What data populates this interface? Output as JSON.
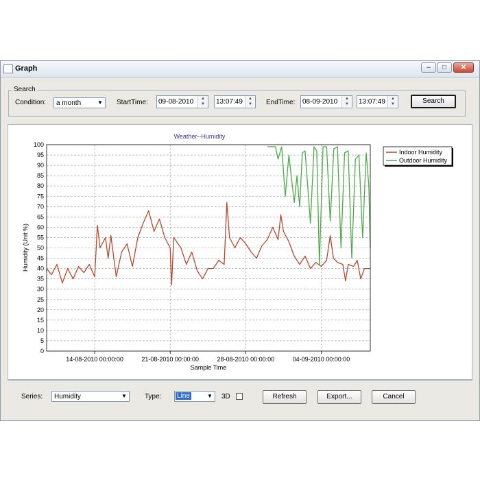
{
  "window": {
    "title": "Graph"
  },
  "search": {
    "group_label": "Search",
    "condition_label": "Condition:",
    "condition_value": "a month",
    "start_label": "StartTime:",
    "start_date": "09-08-2010",
    "start_time": "13:07:49",
    "end_label": "EndTime:",
    "end_date": "08-09-2010",
    "end_time": "13:07:49",
    "search_button": "Search"
  },
  "bottom": {
    "series_label": "Series:",
    "series_value": "Humidity",
    "type_label": "Type:",
    "type_value": "Line",
    "threed_label": "3D",
    "refresh_button": "Refresh",
    "export_button": "Export...",
    "cancel_button": "Cancel"
  },
  "colors": {
    "indoor": "#b8472a",
    "outdoor": "#4cab46"
  },
  "chart_data": {
    "type": "line",
    "title": "Weather--Humidity",
    "xlabel": "Sample Time",
    "ylabel": "Humidity (Unit:%)",
    "ylim": [
      0,
      100
    ],
    "yticks": [
      0,
      5,
      10,
      15,
      20,
      25,
      30,
      35,
      40,
      45,
      50,
      55,
      60,
      65,
      70,
      75,
      80,
      85,
      90,
      95,
      100
    ],
    "xlim": [
      "2010-08-09 13:07:49",
      "2010-09-08 13:07:49"
    ],
    "xtick_labels": [
      "14-08-2010 00:00:00",
      "21-08-2010 00:00:00",
      "28-08-2010 00:00:00",
      "04-09-2010 00:00:00"
    ],
    "xticks": [
      "2010-08-14 00:00:00",
      "2010-08-21 00:00:00",
      "2010-08-28 00:00:00",
      "2010-09-04 00:00:00"
    ],
    "grid": true,
    "legend_position": "top-right",
    "series": [
      {
        "name": "Indoor Humidity",
        "color": "#b8472a",
        "points": [
          [
            "2010-08-09 13:00",
            40
          ],
          [
            "2010-08-10 00:00",
            37
          ],
          [
            "2010-08-10 12:00",
            42
          ],
          [
            "2010-08-11 00:00",
            33
          ],
          [
            "2010-08-11 12:00",
            40
          ],
          [
            "2010-08-12 00:00",
            35
          ],
          [
            "2010-08-12 12:00",
            41
          ],
          [
            "2010-08-13 00:00",
            38
          ],
          [
            "2010-08-13 12:00",
            42
          ],
          [
            "2010-08-14 00:00",
            36
          ],
          [
            "2010-08-14 06:00",
            61
          ],
          [
            "2010-08-14 12:00",
            50
          ],
          [
            "2010-08-15 00:00",
            55
          ],
          [
            "2010-08-15 06:00",
            45
          ],
          [
            "2010-08-15 12:00",
            56
          ],
          [
            "2010-08-16 00:00",
            36
          ],
          [
            "2010-08-16 12:00",
            48
          ],
          [
            "2010-08-17 00:00",
            52
          ],
          [
            "2010-08-17 12:00",
            41
          ],
          [
            "2010-08-18 00:00",
            55
          ],
          [
            "2010-08-18 12:00",
            62
          ],
          [
            "2010-08-19 00:00",
            68
          ],
          [
            "2010-08-19 12:00",
            58
          ],
          [
            "2010-08-20 00:00",
            64
          ],
          [
            "2010-08-20 12:00",
            55
          ],
          [
            "2010-08-21 00:00",
            50
          ],
          [
            "2010-08-21 03:00",
            32
          ],
          [
            "2010-08-21 08:00",
            55
          ],
          [
            "2010-08-22 00:00",
            50
          ],
          [
            "2010-08-22 12:00",
            42
          ],
          [
            "2010-08-23 00:00",
            48
          ],
          [
            "2010-08-23 12:00",
            39
          ],
          [
            "2010-08-24 00:00",
            35
          ],
          [
            "2010-08-24 12:00",
            40
          ],
          [
            "2010-08-25 00:00",
            40
          ],
          [
            "2010-08-25 12:00",
            44
          ],
          [
            "2010-08-26 00:00",
            42
          ],
          [
            "2010-08-26 06:00",
            72
          ],
          [
            "2010-08-26 12:00",
            55
          ],
          [
            "2010-08-27 00:00",
            50
          ],
          [
            "2010-08-27 12:00",
            55
          ],
          [
            "2010-08-28 00:00",
            52
          ],
          [
            "2010-08-28 12:00",
            48
          ],
          [
            "2010-08-29 00:00",
            45
          ],
          [
            "2010-08-29 12:00",
            51
          ],
          [
            "2010-08-30 00:00",
            54
          ],
          [
            "2010-08-30 12:00",
            60
          ],
          [
            "2010-08-31 00:00",
            54
          ],
          [
            "2010-08-31 06:00",
            66
          ],
          [
            "2010-08-31 12:00",
            58
          ],
          [
            "2010-09-01 00:00",
            53
          ],
          [
            "2010-09-01 12:00",
            46
          ],
          [
            "2010-09-02 00:00",
            42
          ],
          [
            "2010-09-02 12:00",
            46
          ],
          [
            "2010-09-03 00:00",
            40
          ],
          [
            "2010-09-03 12:00",
            43
          ],
          [
            "2010-09-04 00:00",
            41
          ],
          [
            "2010-09-04 12:00",
            44
          ],
          [
            "2010-09-04 20:00",
            56
          ],
          [
            "2010-09-05 03:00",
            45
          ],
          [
            "2010-09-05 12:00",
            43
          ],
          [
            "2010-09-06 00:00",
            42
          ],
          [
            "2010-09-06 06:00",
            34
          ],
          [
            "2010-09-06 12:00",
            42
          ],
          [
            "2010-09-07 00:00",
            41
          ],
          [
            "2010-09-07 08:00",
            44
          ],
          [
            "2010-09-07 16:00",
            35
          ],
          [
            "2010-09-08 00:00",
            40
          ],
          [
            "2010-09-08 13:00",
            40
          ]
        ]
      },
      {
        "name": "Outdoor Humidity",
        "color": "#4cab46",
        "points": [
          [
            "2010-08-30 00:00",
            99
          ],
          [
            "2010-08-30 18:00",
            99
          ],
          [
            "2010-08-31 00:00",
            93
          ],
          [
            "2010-08-31 08:00",
            99
          ],
          [
            "2010-08-31 16:00",
            75
          ],
          [
            "2010-09-01 00:00",
            95
          ],
          [
            "2010-09-01 12:00",
            72
          ],
          [
            "2010-09-01 18:00",
            85
          ],
          [
            "2010-09-02 00:00",
            70
          ],
          [
            "2010-09-02 06:00",
            96
          ],
          [
            "2010-09-02 12:00",
            97
          ],
          [
            "2010-09-03 00:00",
            62
          ],
          [
            "2010-09-03 08:00",
            99
          ],
          [
            "2010-09-03 14:00",
            97
          ],
          [
            "2010-09-03 20:00",
            42
          ],
          [
            "2010-09-04 04:00",
            99
          ],
          [
            "2010-09-04 12:00",
            99
          ],
          [
            "2010-09-04 20:00",
            63
          ],
          [
            "2010-09-05 04:00",
            98
          ],
          [
            "2010-09-05 12:00",
            99
          ],
          [
            "2010-09-05 20:00",
            50
          ],
          [
            "2010-09-06 04:00",
            96
          ],
          [
            "2010-09-06 12:00",
            97
          ],
          [
            "2010-09-06 20:00",
            45
          ],
          [
            "2010-09-07 04:00",
            93
          ],
          [
            "2010-09-07 12:00",
            95
          ],
          [
            "2010-09-07 20:00",
            55
          ],
          [
            "2010-09-08 04:00",
            96
          ],
          [
            "2010-09-08 10:00",
            80
          ],
          [
            "2010-09-08 13:00",
            50
          ]
        ]
      }
    ]
  }
}
